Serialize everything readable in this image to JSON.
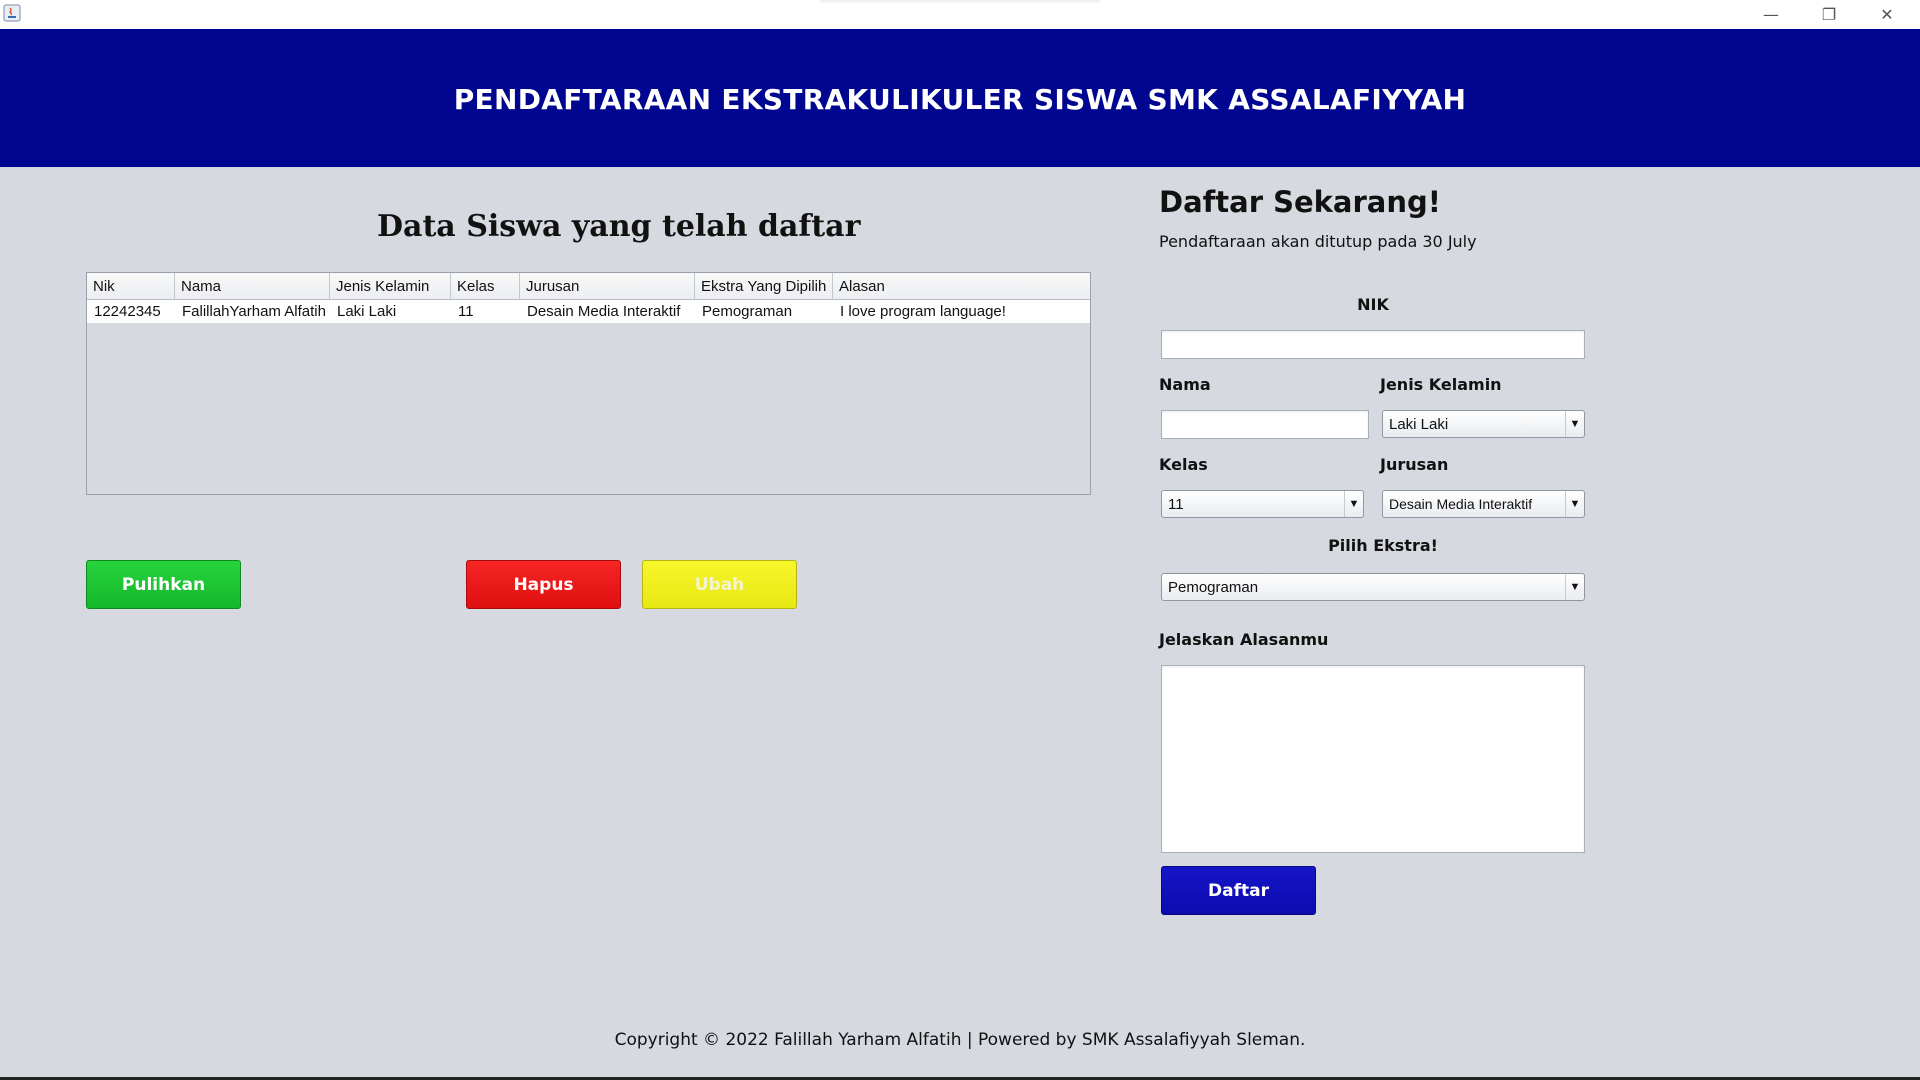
{
  "window": {
    "controls": {
      "minimize": "—",
      "restore": "❐",
      "close": "✕"
    }
  },
  "header": {
    "title": "PENDAFTARAAN EKSTRAKULIKULER SISWA SMK ASSALAFIYYAH",
    "background": "#00068f"
  },
  "list": {
    "title": "Data Siswa yang telah daftar",
    "columns": [
      "Nik",
      "Nama",
      "Jenis Kelamin",
      "Kelas",
      "Jurusan",
      "Ekstra Yang Dipilih",
      "Alasan"
    ],
    "rows": [
      [
        "12242345",
        "FalillahYarham Alfatih",
        "Laki Laki",
        "11",
        "Desain Media Interaktif",
        "Pemograman",
        "I love program language!"
      ]
    ]
  },
  "actions": {
    "restore_label": "Pulihkan",
    "delete_label": "Hapus",
    "edit_label": "Ubah"
  },
  "form": {
    "title": "Daftar Sekarang!",
    "subtitle": "Pendaftaraan akan ditutup pada 30 July",
    "nik_label": "NIK",
    "nik_value": "",
    "name_label": "Nama",
    "name_value": "",
    "gender_label": "Jenis Kelamin",
    "gender_value": "Laki Laki",
    "class_label": "Kelas",
    "class_value": "11",
    "major_label": "Jurusan",
    "major_value": "Desain Media Interaktif",
    "extra_label": "Pilih Ekstra!",
    "extra_value": "Pemograman",
    "reason_label": "Jelaskan Alasanmu",
    "reason_value": "",
    "submit_label": "Daftar"
  },
  "colors": {
    "restore": "#1fc233",
    "delete": "#ea1a1a",
    "edit": "#eeee20",
    "submit": "#1010bb"
  },
  "footer": {
    "text": "Copyright © 2022 Falillah Yarham Alfatih | Powered by SMK Assalafiyyah Sleman."
  }
}
